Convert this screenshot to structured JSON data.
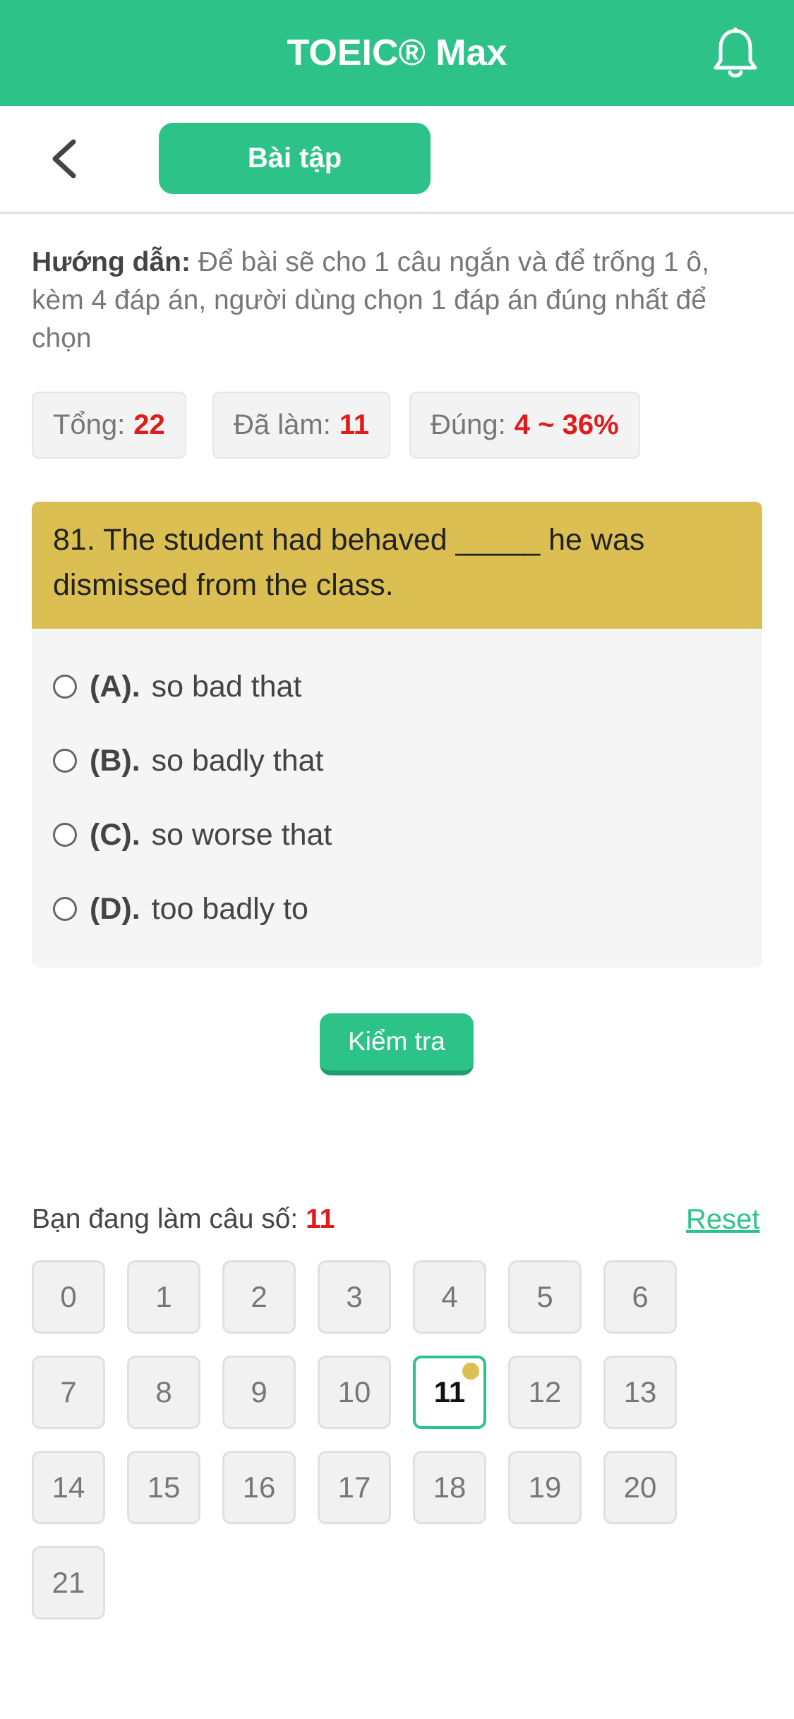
{
  "header": {
    "title": "TOEIC® Max",
    "bell_icon": "bell-icon"
  },
  "subbar": {
    "back_icon": "chevron-left-icon",
    "tab_label": "Bài tập"
  },
  "instruction": {
    "label": "Hướng dẫn:",
    "text": " Để bài sẽ cho 1 câu ngắn và để trống 1 ô, kèm 4 đáp án, người dùng chọn 1 đáp án đúng nhất để chọn"
  },
  "stats": {
    "total_label": "Tổng:",
    "total_value": "22",
    "done_label": "Đã làm:",
    "done_value": "11",
    "correct_label": "Đúng:",
    "correct_value": "4 ~ 36%"
  },
  "question": {
    "text": "81. The student had behaved _____ he was dismissed from the class.",
    "options": [
      {
        "letter": "(A).",
        "text": "so bad that"
      },
      {
        "letter": "(B).",
        "text": "so badly that"
      },
      {
        "letter": "(C).",
        "text": "so worse that"
      },
      {
        "letter": "(D).",
        "text": "too badly to"
      }
    ]
  },
  "check_button": "Kiểm tra",
  "progress": {
    "label": "Bạn đang làm câu số:",
    "current": "11",
    "reset_label": "Reset"
  },
  "questions_grid": [
    "0",
    "1",
    "2",
    "3",
    "4",
    "5",
    "6",
    "7",
    "8",
    "9",
    "10",
    "11",
    "12",
    "13",
    "14",
    "15",
    "16",
    "17",
    "18",
    "19",
    "20",
    "21"
  ],
  "colors": {
    "primary": "#2dc388",
    "question_header": "#dcbf52",
    "accent_red": "#e01b1b"
  }
}
